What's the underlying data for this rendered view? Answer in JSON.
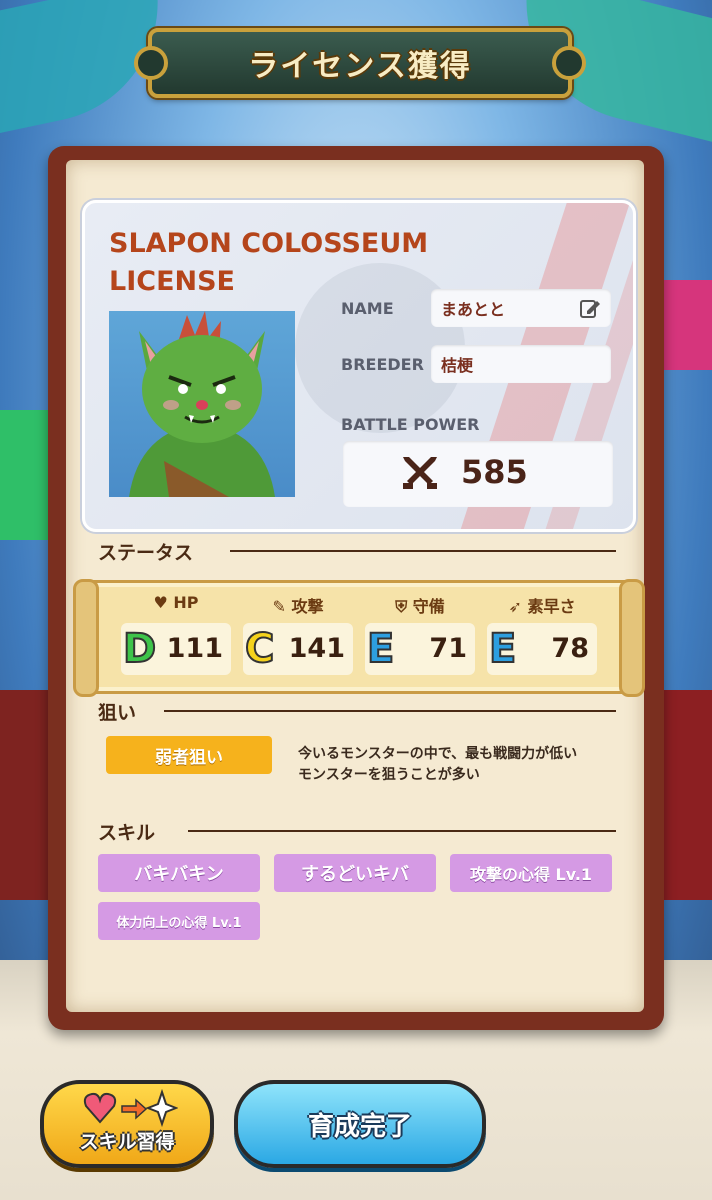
{
  "header": {
    "title": "ライセンス獲得"
  },
  "license": {
    "title_line1": "SLAPON COLOSSEUM",
    "title_line2": "LICENSE",
    "name_label": "NAME",
    "name_value": "まあとと",
    "breeder_label": "BREEDER",
    "breeder_value": "桔梗",
    "battle_power_label": "BATTLE POWER",
    "battle_power_value": "585"
  },
  "status": {
    "heading": "ステータス",
    "stats": [
      {
        "label": "HP",
        "grade": "D",
        "value": "111",
        "grade_color": "#3ec44a",
        "icon": "heart-icon"
      },
      {
        "label": "攻撃",
        "grade": "C",
        "value": "141",
        "grade_color": "#f4d21c",
        "icon": "attack-icon"
      },
      {
        "label": "守備",
        "grade": "E",
        "value": "71",
        "grade_color": "#2d9fe0",
        "icon": "shield-icon"
      },
      {
        "label": "素早さ",
        "grade": "E",
        "value": "78",
        "grade_color": "#2d9fe0",
        "icon": "boot-icon"
      }
    ]
  },
  "aim": {
    "heading": "狙い",
    "badge": "弱者狙い",
    "desc_line1": "今いるモンスターの中で、最も戦闘力が低い",
    "desc_line2": "モンスターを狙うことが多い"
  },
  "skills": {
    "heading": "スキル",
    "items": [
      "バキバキン",
      "するどいキバ",
      "攻撃の心得 Lv.1",
      "体力向上の心得 Lv.1"
    ]
  },
  "buttons": {
    "skill_learn": "スキル習得",
    "finish": "育成完了"
  }
}
